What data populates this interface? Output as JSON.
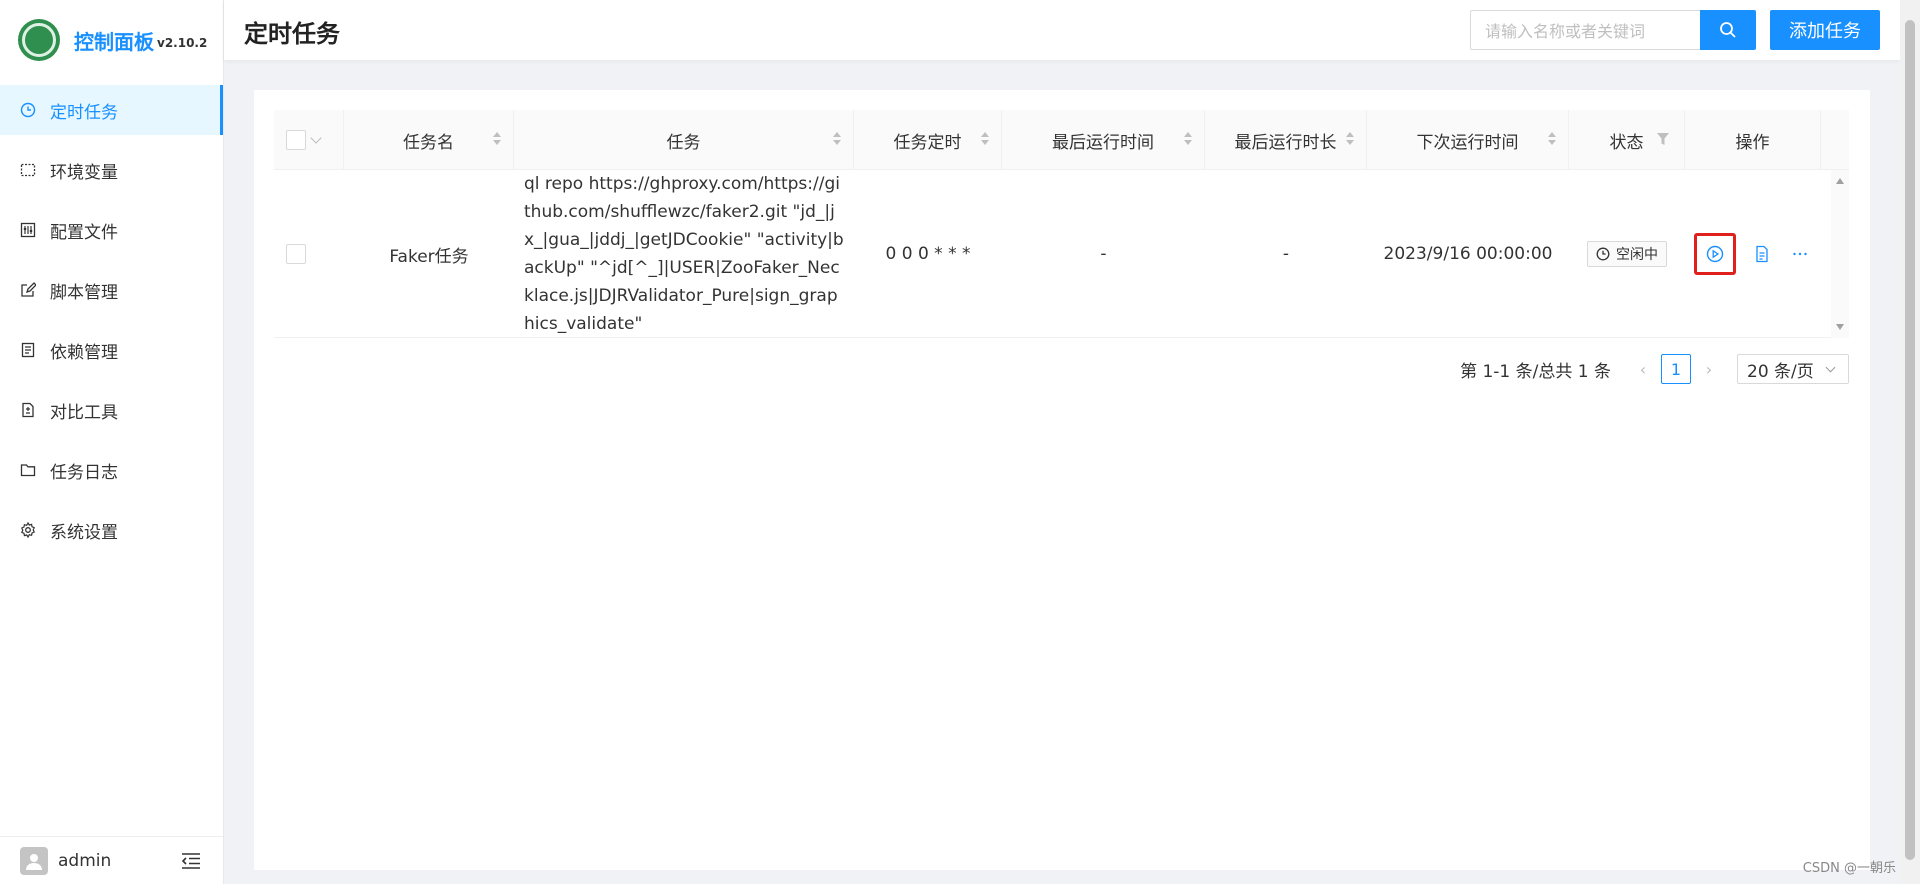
{
  "app": {
    "title": "控制面板",
    "version": "v2.10.2"
  },
  "sidebar": {
    "items": [
      {
        "label": "定时任务",
        "icon": "clock-icon",
        "active": true
      },
      {
        "label": "环境变量",
        "icon": "variable-icon"
      },
      {
        "label": "配置文件",
        "icon": "config-icon"
      },
      {
        "label": "脚本管理",
        "icon": "edit-icon"
      },
      {
        "label": "依赖管理",
        "icon": "dependency-icon"
      },
      {
        "label": "对比工具",
        "icon": "diff-icon"
      },
      {
        "label": "任务日志",
        "icon": "folder-icon"
      },
      {
        "label": "系统设置",
        "icon": "gear-icon"
      }
    ],
    "user": "admin"
  },
  "header": {
    "title": "定时任务",
    "search_placeholder": "请输入名称或者关键词",
    "add_label": "添加任务"
  },
  "table": {
    "columns": [
      "任务名",
      "任务",
      "任务定时",
      "最后运行时间",
      "最后运行时长",
      "下次运行时间",
      "状态",
      "操作"
    ],
    "rows": [
      {
        "name": "Faker任务",
        "command": "ql repo https://ghproxy.com/https://github.com/shufflewzc/faker2.git \"jd_|jx_|gua_|jddj_|getJDCookie\" \"activity|backUp\" \"^jd[^_]|USER|ZooFaker_Necklace.js|JDJRValidator_Pure|sign_graphics_validate\"",
        "schedule": "0 0 0 * * *",
        "last_run": "-",
        "last_duration": "-",
        "next_run": "2023/9/16 00:00:00",
        "status": "空闲中"
      }
    ]
  },
  "pagination": {
    "total": "第 1-1 条/总共 1 条",
    "current": "1",
    "page_size": "20 条/页"
  },
  "watermark": "CSDN @一朝乐",
  "colors": {
    "accent": "#1890ff",
    "highlight": "#e0201c"
  }
}
